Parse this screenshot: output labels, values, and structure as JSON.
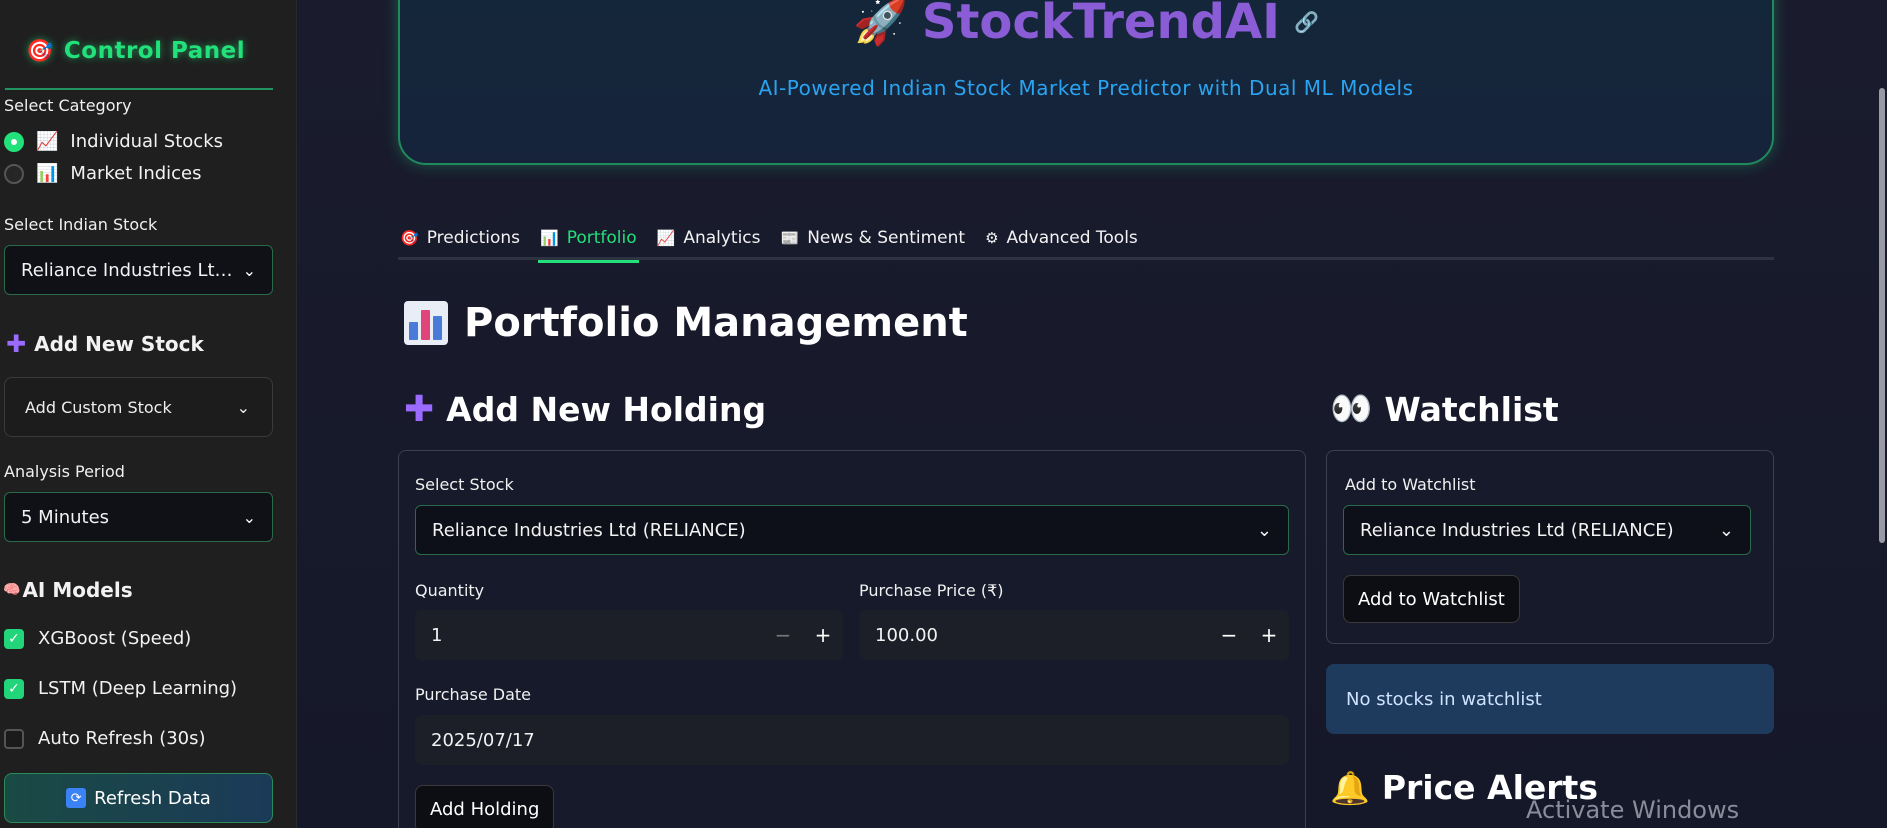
{
  "sidebar": {
    "title": "Control Panel",
    "title_icon": "target-icon",
    "category_label": "Select Category",
    "categories": [
      {
        "label": "Individual Stocks",
        "icon": "chart-up-icon",
        "selected": true
      },
      {
        "label": "Market Indices",
        "icon": "bar-chart-icon",
        "selected": false
      }
    ],
    "stock_label": "Select Indian Stock",
    "stock_value": "Reliance Industries Lt…",
    "add_stock_heading": "Add New Stock",
    "add_custom_label": "Add Custom Stock",
    "period_label": "Analysis Period",
    "period_value": "5 Minutes",
    "models_heading": "AI Models",
    "models": [
      {
        "label": "XGBoost (Speed)",
        "checked": true
      },
      {
        "label": "LSTM (Deep Learning)",
        "checked": true
      },
      {
        "label": "Auto Refresh (30s)",
        "checked": false
      }
    ],
    "refresh_label": "Refresh Data"
  },
  "hero": {
    "title": "StockTrendAI",
    "subtitle": "AI-Powered Indian Stock Market Predictor with Dual ML Models"
  },
  "tabs": [
    {
      "label": "Predictions",
      "icon": "target-icon",
      "active": false
    },
    {
      "label": "Portfolio",
      "icon": "bar-chart-icon",
      "active": true
    },
    {
      "label": "Analytics",
      "icon": "chart-up-icon",
      "active": false
    },
    {
      "label": "News & Sentiment",
      "icon": "newspaper-icon",
      "active": false
    },
    {
      "label": "Advanced Tools",
      "icon": "gear-icon",
      "active": false
    }
  ],
  "portfolio": {
    "heading": "Portfolio Management",
    "add_holding_heading": "Add New Holding",
    "select_stock_label": "Select Stock",
    "select_stock_value": "Reliance Industries Ltd (RELIANCE)",
    "quantity_label": "Quantity",
    "quantity_value": "1",
    "price_label": "Purchase Price (₹)",
    "price_value": "100.00",
    "date_label": "Purchase Date",
    "date_value": "2025/07/17",
    "add_holding_button": "Add Holding"
  },
  "watchlist": {
    "heading": "Watchlist",
    "add_label": "Add to Watchlist",
    "select_value": "Reliance Industries Ltd (RELIANCE)",
    "add_button": "Add to Watchlist",
    "empty_message": "No stocks in watchlist"
  },
  "alerts": {
    "heading": "Price Alerts"
  },
  "os": {
    "watermark": "Activate Windows"
  },
  "colors": {
    "accent_green": "#22e07a",
    "title_purple": "#8a5cd6",
    "subtitle_blue": "#2aa4f0"
  }
}
